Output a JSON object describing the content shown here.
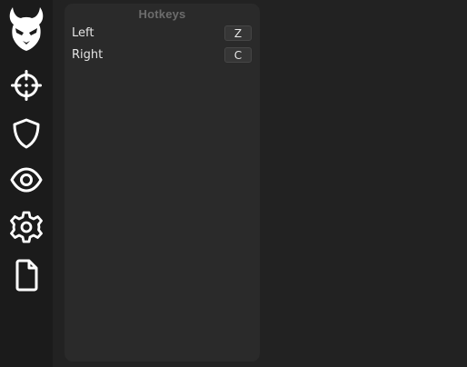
{
  "sidebar": {
    "icons": [
      "demon-logo",
      "crosshair-icon",
      "shield-icon",
      "eye-icon",
      "gear-icon",
      "file-icon"
    ]
  },
  "panel": {
    "title": "Hotkeys",
    "rows": [
      {
        "label": "Left",
        "key": "Z"
      },
      {
        "label": "Right",
        "key": "C"
      }
    ]
  },
  "colors": {
    "sidebar_bg": "#1b1b1b",
    "content_bg": "#222222",
    "panel_bg": "#2a2a2a",
    "key_bg": "#363636",
    "text": "#e4e4e4",
    "title": "#6c6c6c",
    "icon": "#ffffff"
  }
}
